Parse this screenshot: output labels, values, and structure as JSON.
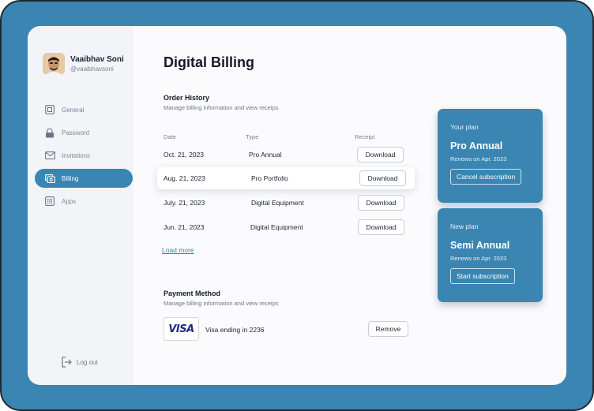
{
  "user": {
    "name": "Vaaibhav Soni",
    "handle": "@vaaibhavsoni"
  },
  "sidebar": {
    "items": [
      {
        "label": "General",
        "icon": "general-icon"
      },
      {
        "label": "Password",
        "icon": "lock-icon"
      },
      {
        "label": "Invitations",
        "icon": "mail-icon"
      },
      {
        "label": "Billing",
        "icon": "billing-icon",
        "active": true
      },
      {
        "label": "Apps",
        "icon": "apps-grid-icon"
      }
    ],
    "logout_label": "Log out"
  },
  "page": {
    "title": "Digital Billing"
  },
  "order_history": {
    "title": "Order History",
    "subtitle": "Manage billing information and view receips",
    "columns": {
      "date": "Date",
      "type": "Type",
      "receipt": "Receipt"
    },
    "rows": [
      {
        "date": "Oct. 21, 2023",
        "type": "Pro Annual",
        "action": "Download"
      },
      {
        "date": "Aug. 21, 2023",
        "type": "Pro Portfolio",
        "action": "Download"
      },
      {
        "date": "July. 21, 2023",
        "type": "Digital Equipment",
        "action": "Download"
      },
      {
        "date": "Jun. 21, 2023",
        "type": "Digital Equipment",
        "action": "Download"
      }
    ],
    "load_more": "Load more"
  },
  "payment_method": {
    "title": "Payment Method",
    "subtitle": "Manage billing information and view receips",
    "card_brand": "VISA",
    "card_text": "Visa ending in 2236",
    "remove_label": "Remove"
  },
  "plans": {
    "current": {
      "label": "Your plan",
      "name": "Pro Annual",
      "renews": "Renews on Apr. 2023",
      "button": "Cancel subscription"
    },
    "new": {
      "label": "New plan",
      "name": "Semi Annual",
      "renews": "Renews on Apr. 2023",
      "button": "Start subscription"
    }
  },
  "colors": {
    "accent": "#3a85b2",
    "text": "#1c2433",
    "muted": "#7a8294"
  }
}
